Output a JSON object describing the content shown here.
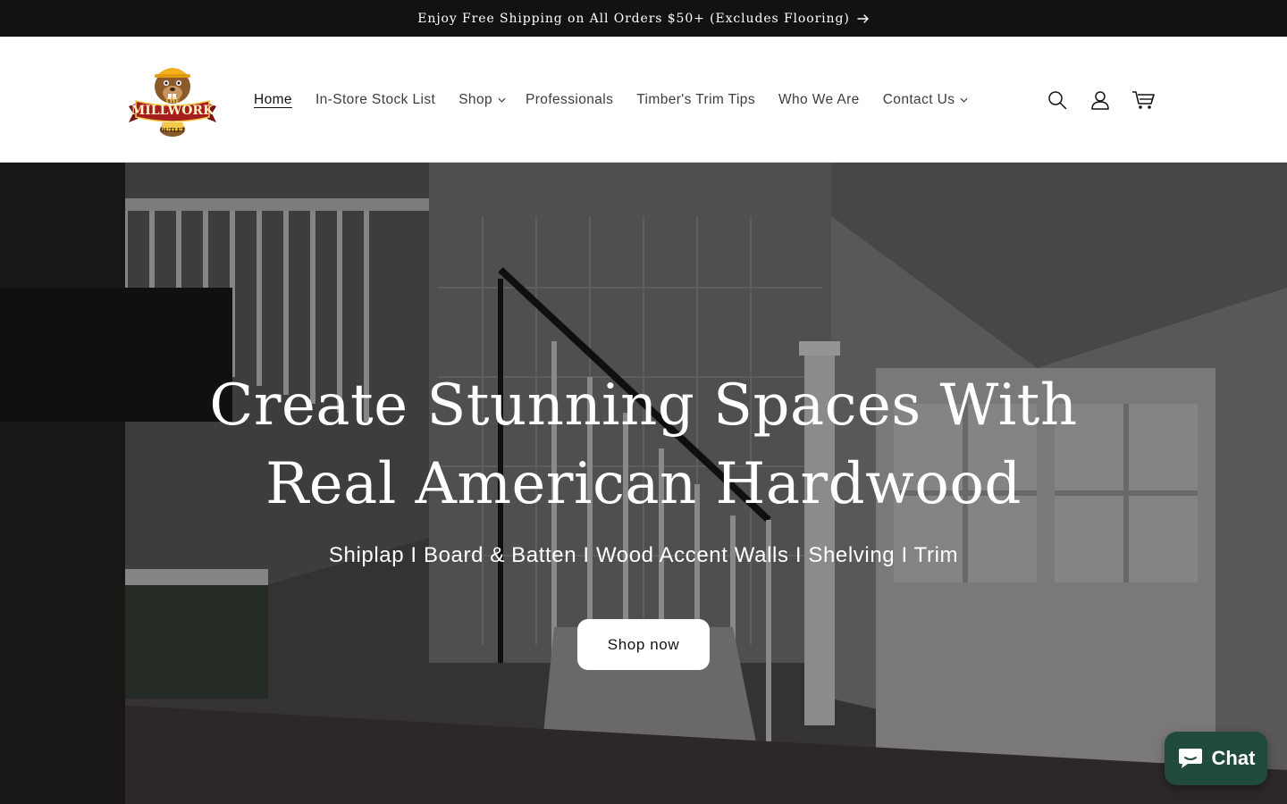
{
  "announcement": {
    "text": "Enjoy Free Shipping on All Orders $50+ (Excludes Flooring)",
    "arrow_icon": "arrow-right-icon"
  },
  "header": {
    "logo": {
      "line1": "THE",
      "line2": "MILLWORK",
      "line3": "OUTLET"
    },
    "nav": [
      {
        "label": "Home",
        "active": true
      },
      {
        "label": "In-Store Stock List"
      },
      {
        "label": "Shop",
        "has_dropdown": true
      },
      {
        "label": "Professionals"
      },
      {
        "label": "Timber's Trim Tips"
      },
      {
        "label": "Who We Are"
      },
      {
        "label": "Contact Us",
        "has_dropdown": true
      }
    ],
    "icons": [
      "search-icon",
      "account-icon",
      "cart-icon"
    ]
  },
  "hero": {
    "title": "Create Stunning Spaces With Real American Hardwood",
    "subtitle": "Shiplap I Board & Batten I Wood Accent Walls I Shelving I Trim",
    "button_label": "Shop now"
  },
  "chat": {
    "label": "Chat",
    "color": "#1f4a3d"
  },
  "colors": {
    "announcement_bg": "#121212",
    "accent": "#1f4a3d"
  }
}
